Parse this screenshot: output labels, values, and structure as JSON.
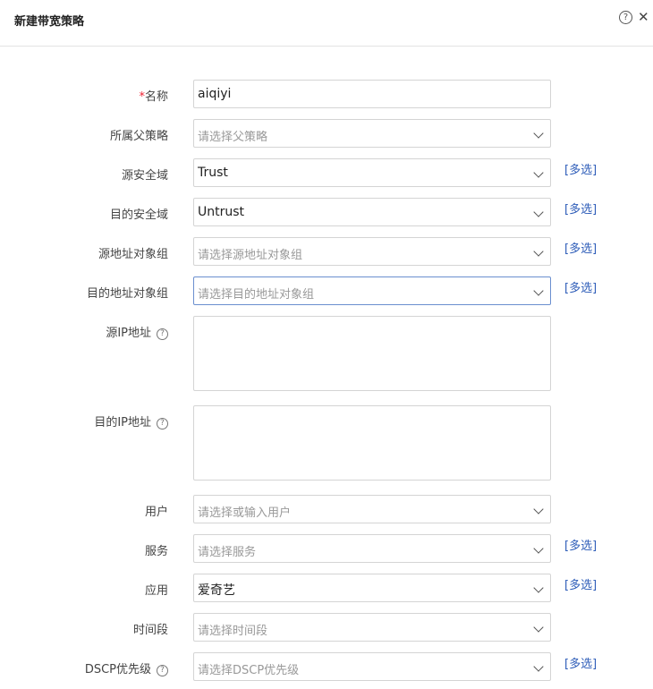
{
  "dialog": {
    "title": "新建带宽策略",
    "help_glyph": "?",
    "close_glyph": "✕"
  },
  "form": {
    "required_mark": "*",
    "multi_select_label": "[多选]",
    "q_glyph": "?",
    "name": {
      "label": "名称",
      "value": "aiqiyi"
    },
    "parent_policy": {
      "label": "所属父策略",
      "placeholder": "请选择父策略"
    },
    "src_zone": {
      "label": "源安全域",
      "value": "Trust"
    },
    "dst_zone": {
      "label": "目的安全域",
      "value": "Untrust"
    },
    "src_addr_group": {
      "label": "源地址对象组",
      "placeholder": "请选择源地址对象组"
    },
    "dst_addr_group": {
      "label": "目的地址对象组",
      "placeholder": "请选择目的地址对象组"
    },
    "src_ip": {
      "label": "源IP地址"
    },
    "dst_ip": {
      "label": "目的IP地址"
    },
    "user": {
      "label": "用户",
      "placeholder": "请选择或输入用户"
    },
    "service": {
      "label": "服务",
      "placeholder": "请选择服务"
    },
    "application": {
      "label": "应用",
      "value": "爱奇艺"
    },
    "time_range": {
      "label": "时间段",
      "placeholder": "请选择时间段"
    },
    "dscp": {
      "label": "DSCP优先级",
      "placeholder": "请选择DSCP优先级"
    }
  }
}
